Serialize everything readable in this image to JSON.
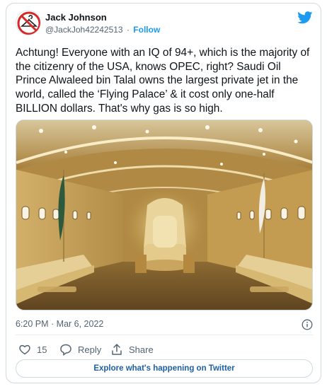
{
  "user": {
    "name": "Jack Johnson",
    "handle": "@JackJoh42242513",
    "separator": "·",
    "follow_label": "Follow"
  },
  "tweet": {
    "text": "Achtung! Everyone with an IQ of 94+, which is the majority of the citizenry of the USA, knows OPEC, right? Saudi Oil Prince Alwaleed bin Talal owns the largest private jet in the world, called the ‘Flying Palace’ & it cost only one-half BILLION dollars. That's why gas is so high.",
    "timestamp": "6:20 PM · Mar 6, 2022"
  },
  "actions": {
    "like_count": "15",
    "reply_label": "Reply",
    "share_label": "Share"
  },
  "explore_label": "Explore what's happening on Twitter",
  "colors": {
    "accent": "#1d9bf0",
    "avatar_ring": "#d62828",
    "text_secondary": "#536471"
  },
  "icons": [
    "no-hanger-avatar",
    "twitter-bird-icon",
    "info-icon",
    "heart-icon",
    "reply-icon",
    "share-icon"
  ]
}
